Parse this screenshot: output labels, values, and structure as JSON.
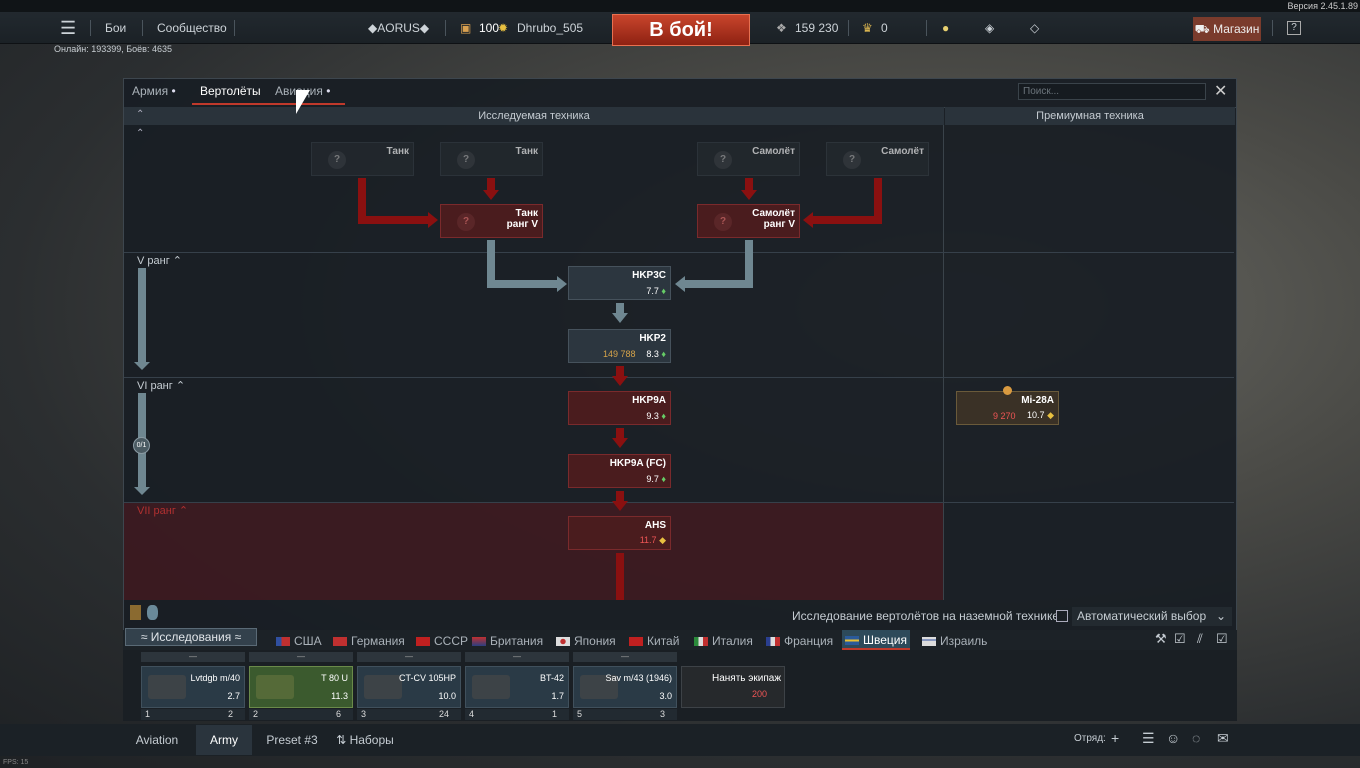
{
  "version": "Версия 2.45.1.89",
  "online": "Онлайн: 193399, Боёв: 4635",
  "fps": "FPS: 15",
  "topbar": {
    "menu_icon": "hamburger-icon",
    "battles": "Бои",
    "community": "Сообщество",
    "squad_tag": "◆AORUS◆",
    "level": "100",
    "nickname": "Dhrubo_505",
    "battle_button": "В бой!",
    "silver": "159 230",
    "gold": "0",
    "shop": "Магазин",
    "help": "?"
  },
  "research": {
    "tabs": [
      {
        "label": "Армия"
      },
      {
        "label": "Вертолёты"
      },
      {
        "label": "Авиация"
      }
    ],
    "search_placeholder": "Поиск...",
    "col_tech": "Исследуемая техника",
    "col_premium": "Премиумная техника",
    "rank_v": "V ранг",
    "rank_vi": "VI ранг",
    "rank_vii": "VII ранг",
    "progress": "0/1",
    "cards": {
      "tank1": {
        "name": "Танк"
      },
      "tank2": {
        "name": "Танк"
      },
      "plane1": {
        "name": "Самолёт"
      },
      "plane2": {
        "name": "Самолёт"
      },
      "tank_rank": {
        "name": "Танк",
        "sub": "ранг V"
      },
      "plane_rank": {
        "name": "Самолёт",
        "sub": "ранг V"
      },
      "hkp3c": {
        "name": "HKP3C",
        "br": "7.7"
      },
      "hkp2": {
        "name": "HKP2",
        "cost": "149 788",
        "br": "8.3"
      },
      "hkp9a": {
        "name": "HKP9A",
        "br": "9.3"
      },
      "hkp9afc": {
        "name": "HKP9A (FC)",
        "br": "9.7"
      },
      "ahs": {
        "name": "AHS",
        "br": "11.7"
      },
      "mi28a": {
        "name": "Mi-28A",
        "cost": "9 270",
        "br": "10.7"
      }
    },
    "ground_research": "Исследование вертолётов на наземной технике",
    "auto_select": "Автоматический выбор"
  },
  "nations": {
    "research_tab": "Исследования",
    "list": [
      {
        "label": "США"
      },
      {
        "label": "Германия"
      },
      {
        "label": "СССР"
      },
      {
        "label": "Британия"
      },
      {
        "label": "Япония"
      },
      {
        "label": "Китай"
      },
      {
        "label": "Италия"
      },
      {
        "label": "Франция"
      },
      {
        "label": "Швеция"
      },
      {
        "label": "Израиль"
      }
    ]
  },
  "crew": {
    "slots": [
      {
        "name": "Lvtdgb m/40",
        "br": "2.7",
        "num": "1",
        "rank": "2"
      },
      {
        "name": "T 80 U",
        "br": "11.3",
        "num": "2",
        "rank": "6"
      },
      {
        "name": "CT-CV 105HP",
        "br": "10.0",
        "num": "3",
        "rank": "24"
      },
      {
        "name": "BT-42",
        "br": "1.7",
        "num": "4",
        "rank": "1"
      },
      {
        "name": "Sav m/43 (1946)",
        "br": "3.0",
        "num": "5",
        "rank": "3"
      }
    ],
    "hire": "Нанять экипаж",
    "hire_cost": "200"
  },
  "bottombar": {
    "aviation": "Aviation",
    "army": "Army",
    "preset": "Preset #3",
    "sets": "Наборы",
    "squad": "Отряд:"
  },
  "colors": {
    "accent": "#c0392b",
    "panel": "#181e24"
  }
}
